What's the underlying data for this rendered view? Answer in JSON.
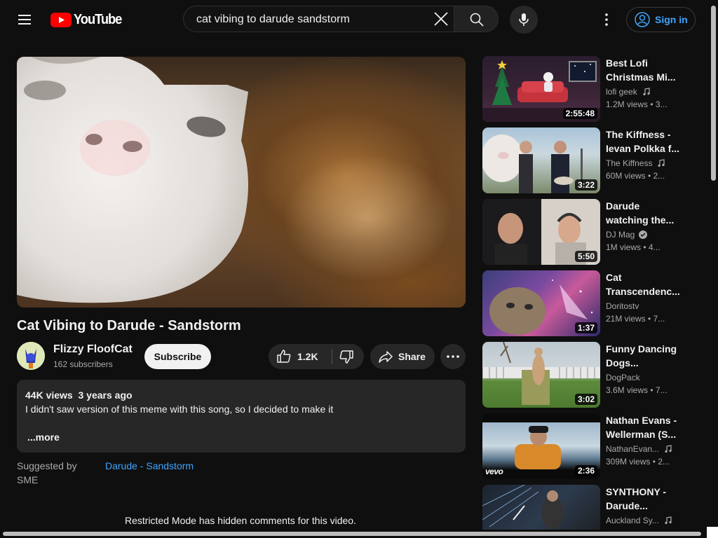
{
  "header": {
    "logo_text": "YouTube",
    "search_value": "cat vibing to darude sandstorm",
    "signin_label": "Sign in"
  },
  "video": {
    "title": "Cat Vibing to Darude - Sandstorm",
    "channel": "Flizzy FloofCat",
    "subscribers": "162 subscribers",
    "subscribe_label": "Subscribe",
    "likes": "1.2K",
    "share_label": "Share",
    "views": "44K views",
    "age": "3 years ago",
    "description": "I didn't saw version of this meme with this song, so I decided to make it",
    "more_label": "...more",
    "suggested_by": "Suggested by SME",
    "song": "Darude - Sandstorm",
    "restricted_note": "Restricted Mode has hidden comments for this video."
  },
  "recommendations": [
    {
      "title1": "Best Lofi",
      "title2": "Christmas Mi...",
      "channel": "lofi geek",
      "badge": "music-note-icon",
      "stats": "1.2M views  • 3...",
      "duration": "2:55:48"
    },
    {
      "title1": "The Kiffness -",
      "title2": "Ievan Polkka f...",
      "channel": "The Kiffness",
      "badge": "music-note-icon",
      "stats": "60M views  • 2...",
      "duration": "3:22"
    },
    {
      "title1": "Darude",
      "title2": "watching the...",
      "channel": "DJ Mag",
      "badge": "verified-icon",
      "stats": "1M views  • 4...",
      "duration": "5:50"
    },
    {
      "title1": "Cat",
      "title2": "Transcendenc...",
      "channel": "Doritostv",
      "badge": "",
      "stats": "21M views  • 7...",
      "duration": "1:37"
    },
    {
      "title1": "Funny Dancing",
      "title2": "Dogs...",
      "channel": "DogPack",
      "badge": "",
      "stats": "3.6M views  • 7...",
      "duration": "3:02"
    },
    {
      "title1": "Nathan Evans -",
      "title2": "Wellerman (S...",
      "channel": "NathanEvan...",
      "badge": "music-note-icon",
      "stats": "309M views  • 2...",
      "duration": "2:36",
      "watermark": "vevo"
    },
    {
      "title1": "SYNTHONY -",
      "title2": "Darude...",
      "channel": "Auckland Sy...",
      "badge": "music-note-icon",
      "stats": "",
      "duration": ""
    }
  ],
  "colors": {
    "accent_link": "#3ea6ff",
    "background": "#0f0f0f",
    "surface": "#272727",
    "logo_red": "#ff0000"
  }
}
